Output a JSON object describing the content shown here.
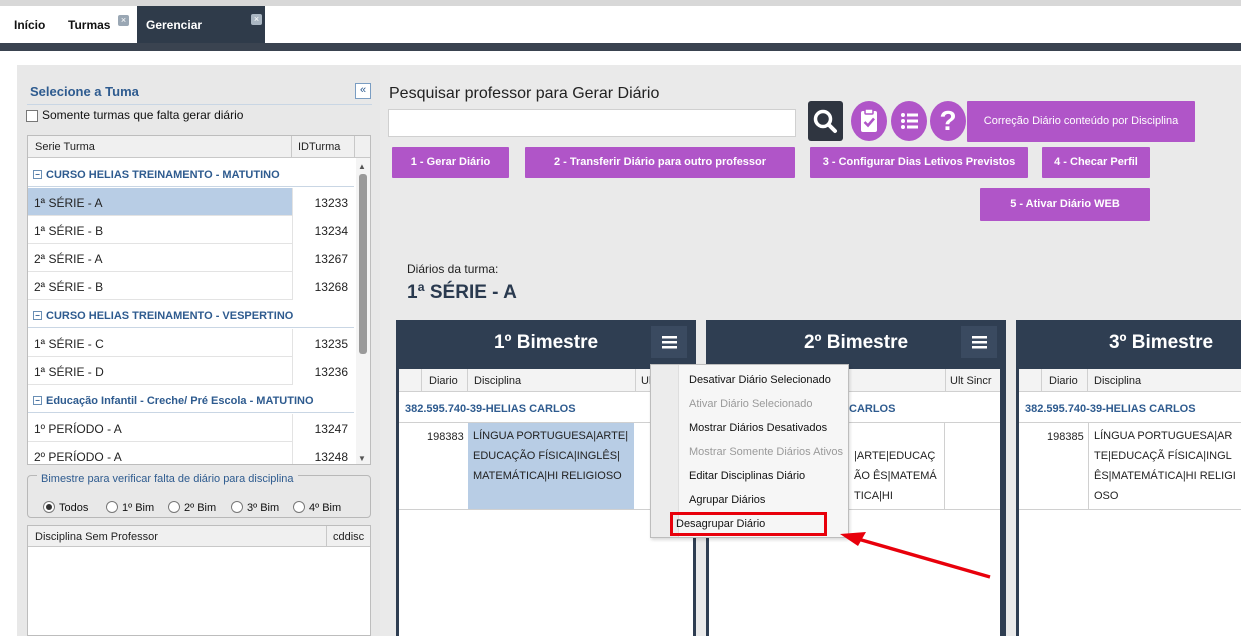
{
  "tabs": [
    {
      "label": "Início"
    },
    {
      "label": "Turmas",
      "closable": true
    },
    {
      "label": "Gerenciar Diários",
      "closable": true,
      "active": true
    }
  ],
  "left_panel": {
    "title": "Selecione a Tuma",
    "only_missing_label": "Somente turmas que falta gerar diário",
    "columns": [
      "Serie Turma",
      "IDTurma"
    ],
    "groups": [
      {
        "name": "CURSO HELIAS TREINAMENTO - MATUTINO",
        "rows": [
          {
            "serie": "1ª SÉRIE - A",
            "id": "13233",
            "selected": true
          },
          {
            "serie": "1ª SÉRIE - B",
            "id": "13234"
          },
          {
            "serie": "2ª SÉRIE - A",
            "id": "13267"
          },
          {
            "serie": "2ª SÉRIE - B",
            "id": "13268"
          }
        ]
      },
      {
        "name": "CURSO HELIAS TREINAMENTO - VESPERTINO",
        "rows": [
          {
            "serie": "1ª SÉRIE - C",
            "id": "13235"
          },
          {
            "serie": "1ª SÉRIE - D",
            "id": "13236"
          }
        ]
      },
      {
        "name": "Educação Infantil - Creche/ Pré Escola - MATUTINO",
        "rows": [
          {
            "serie": "1º PERÍODO - A",
            "id": "13247"
          },
          {
            "serie": "2º PERÍODO - A",
            "id": "13248"
          }
        ]
      }
    ],
    "bimestre_legend": "Bimestre para verificar falta de diário para disciplina",
    "bimestre_options": [
      "Todos",
      "1º Bim",
      "2º Bim",
      "3º Bim",
      "4º Bim"
    ],
    "bimestre_selected": "Todos",
    "sem_prof_columns": [
      "Disciplina Sem Professor",
      "cddisc"
    ]
  },
  "main": {
    "title": "Pesquisar professor para Gerar Diário",
    "search_value": "",
    "correcao_label": "Correção Diário conteúdo por Disciplina",
    "actions": [
      "1 - Gerar Diário",
      "2 - Transferir Diário para outro professor",
      "3 - Configurar Dias Letivos Previstos",
      "4 - Checar Perfil",
      "5 - Ativar Diário WEB"
    ],
    "diarios_label": "Diários da turma:",
    "turma": "1ª SÉRIE - A"
  },
  "bimestres": [
    {
      "title": "1º Bimestre",
      "cols": [
        "Diario",
        "Disciplina",
        "Ult"
      ],
      "prof": "382.595.740-39-HELIAS CARLOS",
      "diario": "198383",
      "disciplina": "LÍNGUA PORTUGUESA|ARTE|EDUCAÇÃO FÍSICA|INGLÊS|MATEMÁTICA|HI RELIGIOSO"
    },
    {
      "title": "2º Bimestre",
      "cols": [
        "Ult Sincr"
      ],
      "prof": "CARLOS",
      "disciplina": "|ARTE|EDUCAÇÃO ÊS|MATEMÁTICA|HI"
    },
    {
      "title": "3º Bimestre",
      "cols": [
        "Diario",
        "Disciplina"
      ],
      "prof": "382.595.740-39-HELIAS CARLOS",
      "diario": "198385",
      "disciplina": "LÍNGUA PORTUGUESA|ARTE|EDUCAÇÃ FÍSICA|INGLÊS|MATEMÁTICA|HI RELIGIOSO"
    }
  ],
  "context_menu": [
    {
      "label": "Desativar Diário Selecionado",
      "enabled": true
    },
    {
      "label": "Ativar Diário Selecionado",
      "enabled": false
    },
    {
      "label": "Mostrar Diários Desativados",
      "enabled": true
    },
    {
      "label": "Mostrar Somente Diários Ativos",
      "enabled": false
    },
    {
      "label": "Editar Disciplinas Diário",
      "enabled": true
    },
    {
      "label": "Agrupar Diários",
      "enabled": true
    },
    {
      "label": "Desagrupar Diário",
      "enabled": true,
      "highlighted": true
    }
  ],
  "colors": {
    "accent": "#b055c8",
    "dark": "#2f3e52",
    "highlight": "#e8000b",
    "selection": "#b8cde5"
  }
}
